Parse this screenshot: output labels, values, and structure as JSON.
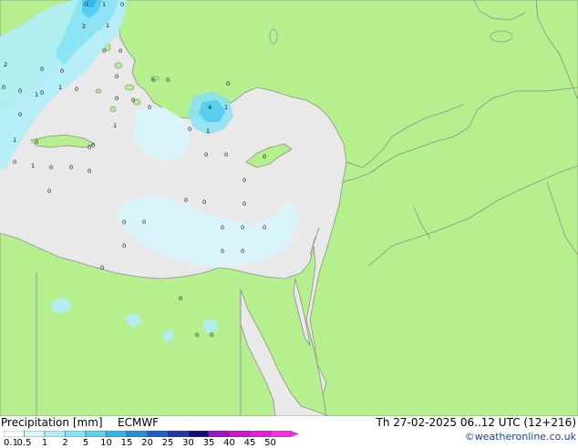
{
  "legend": {
    "title": "Precipitation [mm]",
    "model": "ECMWF",
    "valid_time": "Th 27-02-2025 06..12 UTC (12+216)",
    "credit": "©weatheronline.co.uk",
    "ticks": [
      "0.1",
      "0.5",
      "1",
      "2",
      "5",
      "10",
      "15",
      "20",
      "25",
      "30",
      "35",
      "40",
      "45",
      "50"
    ],
    "colors": [
      "#ffffff",
      "#d8f6fb",
      "#b0eef8",
      "#86e2f4",
      "#58cfee",
      "#31b5e6",
      "#1f8fda",
      "#1f5fcc",
      "#1a3aa8",
      "#120e84",
      "#a010c8",
      "#cc18cc",
      "#e020dc",
      "#f230e6"
    ]
  },
  "map": {
    "land_color": "#b5ef8e",
    "sea_color": "#e9e9e9",
    "border_color": "#8e8e8e",
    "values": [
      {
        "text": "0"
      },
      {
        "text": "1"
      },
      {
        "text": "0"
      },
      {
        "text": "2"
      },
      {
        "text": "1"
      },
      {
        "text": "0"
      },
      {
        "text": "0"
      },
      {
        "text": "2"
      },
      {
        "text": "0"
      },
      {
        "text": "0"
      },
      {
        "text": "0"
      },
      {
        "text": "0"
      },
      {
        "text": "1"
      },
      {
        "text": "0"
      },
      {
        "text": "0"
      },
      {
        "text": "0"
      },
      {
        "text": "1"
      },
      {
        "text": "0"
      },
      {
        "text": "0"
      },
      {
        "text": "0"
      },
      {
        "text": "0"
      },
      {
        "text": "0"
      },
      {
        "text": "0"
      },
      {
        "text": "0"
      },
      {
        "text": "1"
      },
      {
        "text": "0"
      },
      {
        "text": "1"
      },
      {
        "text": "0"
      },
      {
        "text": "0"
      },
      {
        "text": "0"
      },
      {
        "text": "4"
      },
      {
        "text": "1"
      },
      {
        "text": "0"
      },
      {
        "text": "1"
      },
      {
        "text": "0"
      },
      {
        "text": "1"
      },
      {
        "text": "0"
      },
      {
        "text": "0"
      },
      {
        "text": "0"
      },
      {
        "text": "0"
      },
      {
        "text": "0"
      },
      {
        "text": "0"
      },
      {
        "text": "0"
      },
      {
        "text": "0"
      },
      {
        "text": "0"
      },
      {
        "text": "0"
      },
      {
        "text": "0"
      },
      {
        "text": "0"
      },
      {
        "text": "0"
      },
      {
        "text": "0"
      },
      {
        "text": "0"
      },
      {
        "text": "0"
      },
      {
        "text": "0"
      },
      {
        "text": "0"
      },
      {
        "text": "0"
      },
      {
        "text": "0"
      },
      {
        "text": "0"
      },
      {
        "text": "0"
      }
    ]
  }
}
